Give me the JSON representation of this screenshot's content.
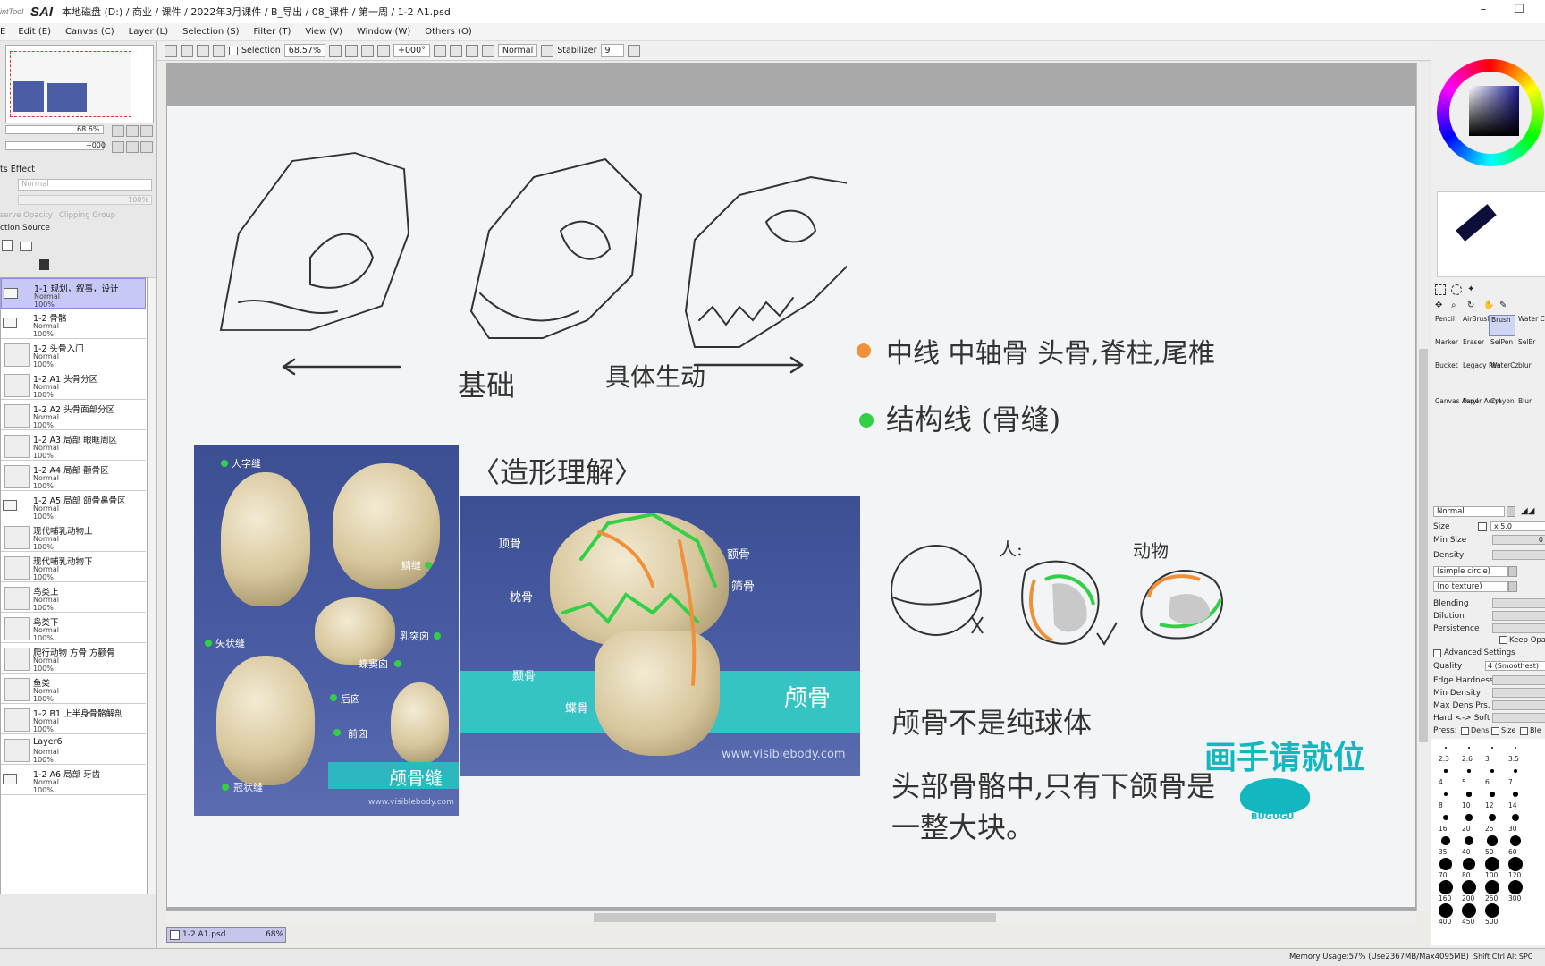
{
  "app": {
    "logo_small": "intTool",
    "logo": "SAI",
    "path": "本地磁盘 (D:) / 商业 / 课件 / 2022年3月课件 / B_导出 / 08_课件 / 第一周 / 1-2 A1.psd"
  },
  "window": {
    "minimize": "–",
    "maximize": "☐",
    "close": "✕"
  },
  "menu": [
    "Edit (E)",
    "Canvas (C)",
    "Layer (L)",
    "Selection (S)",
    "Filter (T)",
    "View (V)",
    "Window (W)",
    "Others (O)"
  ],
  "toolbar": {
    "selection_label": "Selection",
    "zoom": "68.57%",
    "rotation": "+000°",
    "mode": "Normal",
    "stabilizer_label": "Stabilizer",
    "stabilizer_value": "9"
  },
  "navigator": {
    "zoom": "68.6%",
    "angle": "+000"
  },
  "layer_panel": {
    "effect_title": "ts Effect",
    "blend_mode": "Normal",
    "opacity": "100%",
    "preserve_opacity": "serve Opacity",
    "clipping_group": "Clipping Group",
    "selection_source": "ction Source",
    "layers": [
      {
        "name": "1-1 规划，叙事，设计",
        "mode": "Normal",
        "opacity": "100%",
        "folder": true,
        "selected": true
      },
      {
        "name": "1-2 骨骼",
        "mode": "Normal",
        "opacity": "100%",
        "folder": true
      },
      {
        "name": "1-2 头骨入门",
        "mode": "Normal",
        "opacity": "100%"
      },
      {
        "name": "1-2 A1 头骨分区",
        "mode": "Normal",
        "opacity": "100%"
      },
      {
        "name": "1-2 A2 头骨面部分区",
        "mode": "Normal",
        "opacity": "100%"
      },
      {
        "name": "1-2 A3 局部 眼眶周区",
        "mode": "Normal",
        "opacity": "100%"
      },
      {
        "name": "1-2 A4 局部 颧骨区",
        "mode": "Normal",
        "opacity": "100%"
      },
      {
        "name": "1-2 A5 局部 颌骨鼻骨区",
        "mode": "Normal",
        "opacity": "100%",
        "folder": true
      },
      {
        "name": "现代哺乳动物上",
        "mode": "Normal",
        "opacity": "100%"
      },
      {
        "name": "现代哺乳动物下",
        "mode": "Normal",
        "opacity": "100%"
      },
      {
        "name": "鸟类上",
        "mode": "Normal",
        "opacity": "100%"
      },
      {
        "name": "鸟类下",
        "mode": "Normal",
        "opacity": "100%"
      },
      {
        "name": "爬行动物 方骨 方颧骨",
        "mode": "Normal",
        "opacity": "100%"
      },
      {
        "name": "鱼类",
        "mode": "Normal",
        "opacity": "100%"
      },
      {
        "name": "1-2 B1 上半身骨骼解剖",
        "mode": "Normal",
        "opacity": "100%"
      },
      {
        "name": "Layer6",
        "mode": "Normal",
        "opacity": "100%"
      },
      {
        "name": "1-2 A6 局部 牙齿",
        "mode": "Normal",
        "opacity": "100%",
        "folder": true
      }
    ]
  },
  "canvas": {
    "left_arrow_text": "基础",
    "right_arrow_text": "具体生动",
    "bracket_text": "〈造形理解〉",
    "bullet1": "中线  中轴骨 头骨,脊柱,尾椎",
    "bullet2": "结构线 (骨缝)",
    "sphere_labels": {
      "human": "人:",
      "animal": "动物"
    },
    "note_line1": "颅骨不是纯球体",
    "note_line2": "头部骨骼中,只有下颌骨是",
    "note_line3": "一整大块。",
    "panel1": {
      "labels": [
        "人字缝",
        "鳞缝",
        "乳突囟",
        "矢状缝",
        "蝶窦囟",
        "后囟",
        "前囟",
        "冠状缝"
      ],
      "title": "颅骨缝",
      "url": "www.visiblebody.com"
    },
    "panel2": {
      "labels": [
        "顶骨",
        "额骨",
        "枕骨",
        "筛骨",
        "颞骨",
        "蝶骨"
      ],
      "title": "颅骨",
      "url": "www.visiblebody.com"
    },
    "colors": {
      "orange": "#f0913a",
      "green": "#31d047"
    }
  },
  "watermark": {
    "text": "画手请就位",
    "sub": "BUGUGU"
  },
  "tools": [
    "Pencil",
    "AirBrush",
    "Brush",
    "Water Color",
    "Marker",
    "Eraser",
    "SelPen",
    "SelEr",
    "Bucket",
    "Legacy Pen",
    "WaterCz",
    "blur",
    "Canvas Acryl",
    "Paper Acryl",
    "Crayon",
    "Blur"
  ],
  "brush": {
    "mode": "Normal",
    "size_label": "Size",
    "size_mult": "x 5.0",
    "min_size": "Min Size",
    "min_size_val": "0",
    "density": "Density",
    "shape": "(simple circle)",
    "texture": "(no texture)",
    "blending": "Blending",
    "dilution": "Dilution",
    "persistence": "Persistence",
    "keep_opacity": "Keep Opaci",
    "advanced": "Advanced Settings",
    "quality_label": "Quality",
    "quality": "4 (Smoothest)",
    "edge_hardness": "Edge Hardness",
    "min_density": "Min Density",
    "max_dens": "Max Dens Prs.",
    "hard_soft": "Hard <-> Soft",
    "press": "Press:",
    "press_dens": "Dens",
    "press_size": "Size",
    "press_blend": "Ble",
    "sizes": [
      "2.3",
      "2.6",
      "3",
      "3.5",
      "4",
      "5",
      "6",
      "7",
      "8",
      "10",
      "12",
      "14",
      "16",
      "20",
      "25",
      "30",
      "35",
      "40",
      "50",
      "60",
      "70",
      "80",
      "100",
      "120",
      "160",
      "200",
      "250",
      "300",
      "400",
      "450",
      "500"
    ]
  },
  "doc_tab": {
    "name": "1-2 A1.psd",
    "zoom": "68%"
  },
  "status": {
    "memory": "Memory Usage:57% (Use2367MB/Max4095MB)",
    "keys": "Shift Ctrl Alt SPC"
  }
}
